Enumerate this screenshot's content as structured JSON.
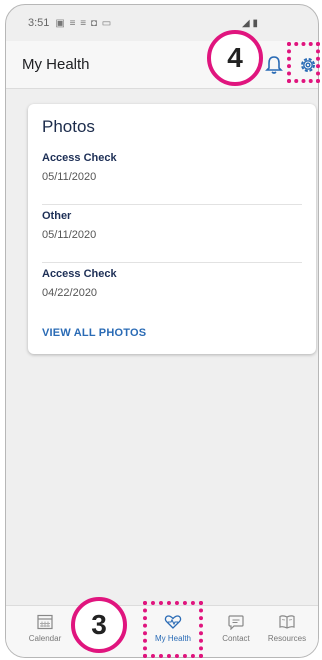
{
  "status_bar": {
    "time": "3:51",
    "icons": "▣ ≡ ≡ ◘ ▭",
    "signal": "◢ ▮"
  },
  "app_bar": {
    "title": "My Health"
  },
  "photos_card": {
    "title": "Photos",
    "items": [
      {
        "name": "Access Check",
        "date": "05/11/2020"
      },
      {
        "name": "Other",
        "date": "05/11/2020"
      },
      {
        "name": "Access Check",
        "date": "04/22/2020"
      }
    ],
    "view_all_label": "VIEW ALL PHOTOS"
  },
  "bottom_nav": {
    "items": [
      {
        "label": "Calendar",
        "icon": "calendar-icon",
        "active": false
      },
      {
        "label": "My Health",
        "icon": "heart-health-icon",
        "active": true
      },
      {
        "label": "Contact",
        "icon": "message-icon",
        "active": false
      },
      {
        "label": "Resources",
        "icon": "book-icon",
        "active": false
      }
    ]
  },
  "callouts": [
    {
      "number": "4",
      "target": "settings"
    },
    {
      "number": "3",
      "target": "my-health-tab"
    }
  ],
  "colors": {
    "accent": "#e0157e",
    "link": "#2a6bb5",
    "title": "#1b2b4b"
  }
}
